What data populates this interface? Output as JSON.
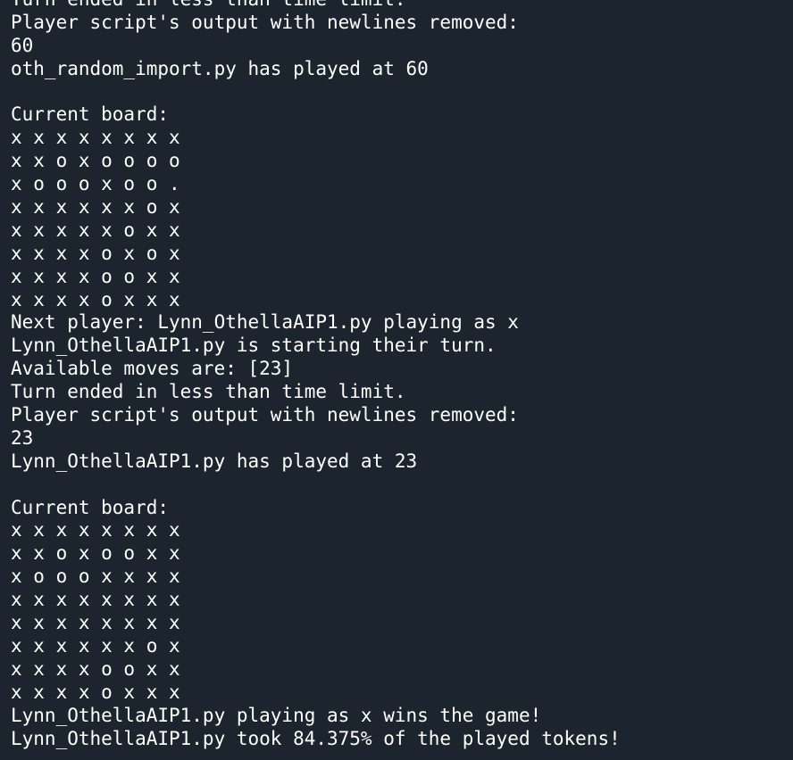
{
  "terminal": {
    "background": "#1c242e",
    "foreground": "#ffffff",
    "lines": [
      "Turn ended in less than time limit.",
      "Player script's output with newlines removed:",
      "60",
      "oth_random_import.py has played at 60",
      "",
      "Current board:",
      "x x x x x x x x",
      "x x o x o o o o",
      "x o o o x o o .",
      "x x x x x x o x",
      "x x x x x o x x",
      "x x x x o x o x",
      "x x x x o o x x",
      "x x x x o x x x",
      "Next player: Lynn_OthellaAIP1.py playing as x",
      "Lynn_OthellaAIP1.py is starting their turn.",
      "Available moves are: [23]",
      "Turn ended in less than time limit.",
      "Player script's output with newlines removed:",
      "23",
      "Lynn_OthellaAIP1.py has played at 23",
      "",
      "Current board:",
      "x x x x x x x x",
      "x x o x o o x x",
      "x o o o x x x x",
      "x x x x x x x x",
      "x x x x x x x x",
      "x x x x x x o x",
      "x x x x o o x x",
      "x x x x o x x x",
      "Lynn_OthellaAIP1.py playing as x wins the game!",
      "Lynn_OthellaAIP1.py took 84.375% of the played tokens!"
    ]
  }
}
